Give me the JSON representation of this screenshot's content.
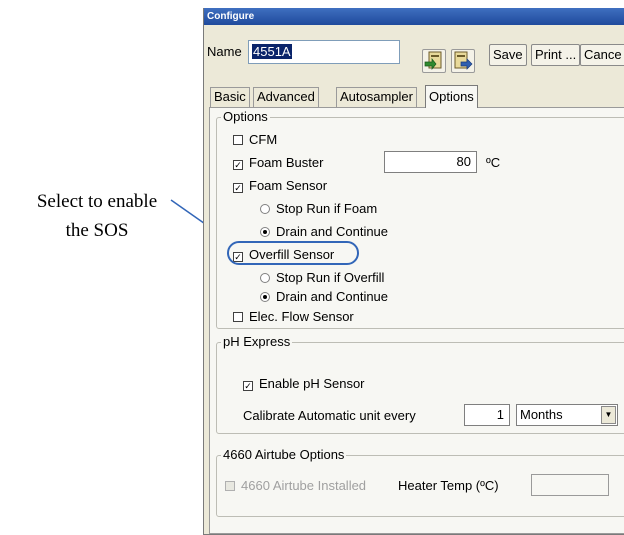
{
  "callout": {
    "line1": "Select to enable",
    "line2": "the SOS"
  },
  "window": {
    "title": "Configure"
  },
  "header": {
    "name_label": "Name",
    "name_value": "4551A",
    "save_label": "Save",
    "print_label": "Print ...",
    "cancel_label": "Cance"
  },
  "tabs": [
    {
      "label": "Basic"
    },
    {
      "label": "Advanced"
    },
    {
      "label": "Autosampler"
    },
    {
      "label": "Options"
    }
  ],
  "options_group": {
    "legend": "Options",
    "cfm": {
      "label": "CFM",
      "checked": false
    },
    "foam_buster": {
      "label": "Foam Buster",
      "checked": true,
      "value": "80",
      "unit": "ºC"
    },
    "foam_sensor": {
      "label": "Foam Sensor",
      "checked": true
    },
    "foam_stop": {
      "label": "Stop Run if Foam",
      "selected": false
    },
    "foam_drain": {
      "label": "Drain and Continue",
      "selected": true
    },
    "overfill_sensor": {
      "label": "Overfill Sensor",
      "checked": true
    },
    "overfill_stop": {
      "label": "Stop Run if Overfill",
      "selected": false
    },
    "overfill_drain": {
      "label": "Drain and Continue",
      "selected": true
    },
    "elec_flow": {
      "label": "Elec. Flow Sensor",
      "checked": false
    }
  },
  "ph_group": {
    "legend": "pH Express",
    "enable_label": "Enable pH Sensor",
    "enable_checked": true,
    "calibrate_label": "Calibrate Automatic unit every",
    "calibrate_value": "1",
    "calibrate_unit": "Months"
  },
  "airtube_group": {
    "legend": "4660 Airtube Options",
    "installed_label": "4660 Airtube Installed",
    "heater_label": "Heater Temp (ºC)",
    "heater_value": ""
  },
  "colors": {
    "highlight": "#3266b8",
    "titlebar": "#2a57a8"
  }
}
